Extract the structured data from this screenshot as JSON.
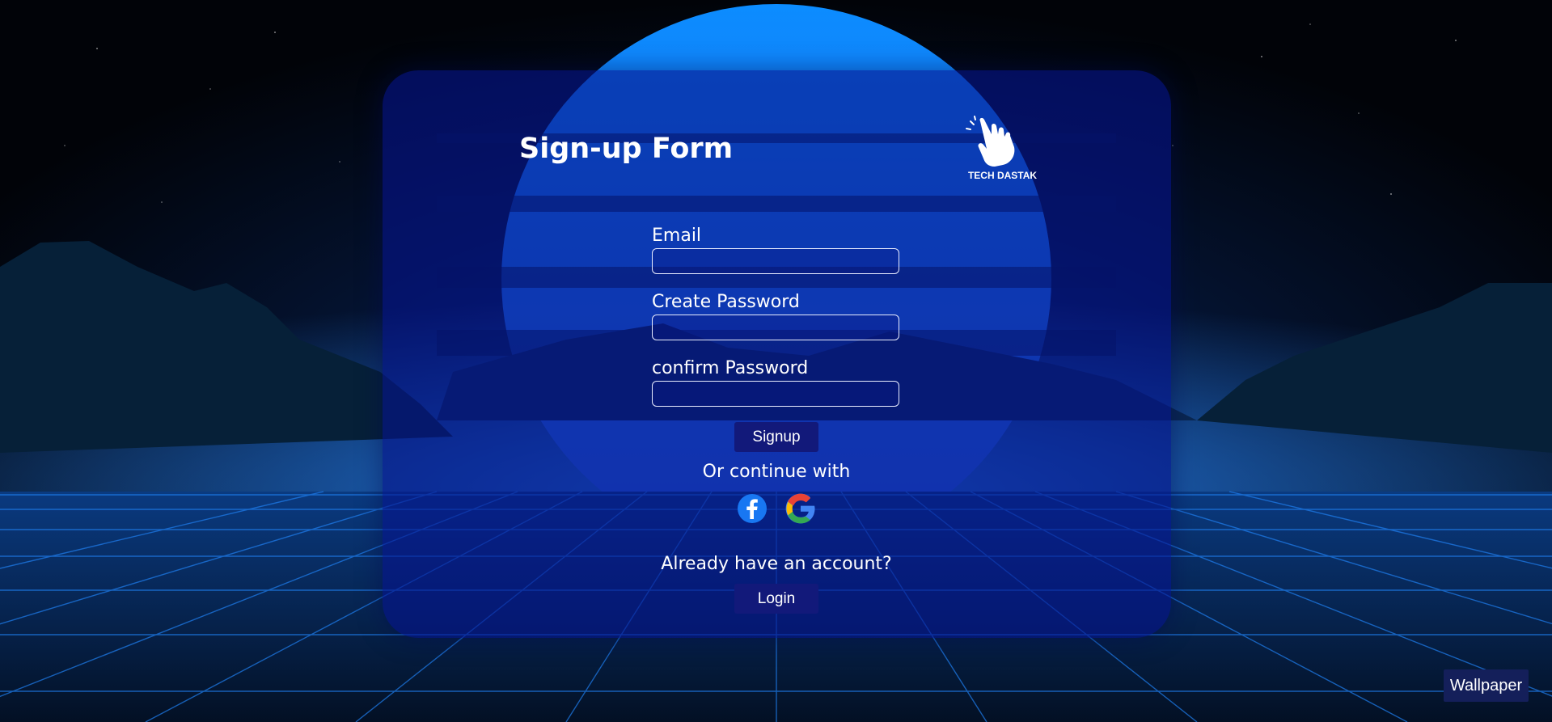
{
  "form": {
    "title": "Sign-up Form",
    "logo_text": "TECH DASTAK",
    "email_label": "Email",
    "email_value": "",
    "create_password_label": "Create Password",
    "create_password_value": "",
    "confirm_password_label": "confirm Password",
    "confirm_password_value": "",
    "signup_label": "Signup",
    "continue_text": "Or continue with",
    "social": [
      "facebook-icon",
      "google-icon"
    ],
    "account_text": "Already have an account?",
    "login_label": "Login"
  },
  "wallpaper_label": "Wallpaper",
  "colors": {
    "card": "#0514a0",
    "button": "#12197a",
    "sun": "#1a7bff",
    "grid": "#1a6fd8",
    "facebook": "#1877f2"
  }
}
